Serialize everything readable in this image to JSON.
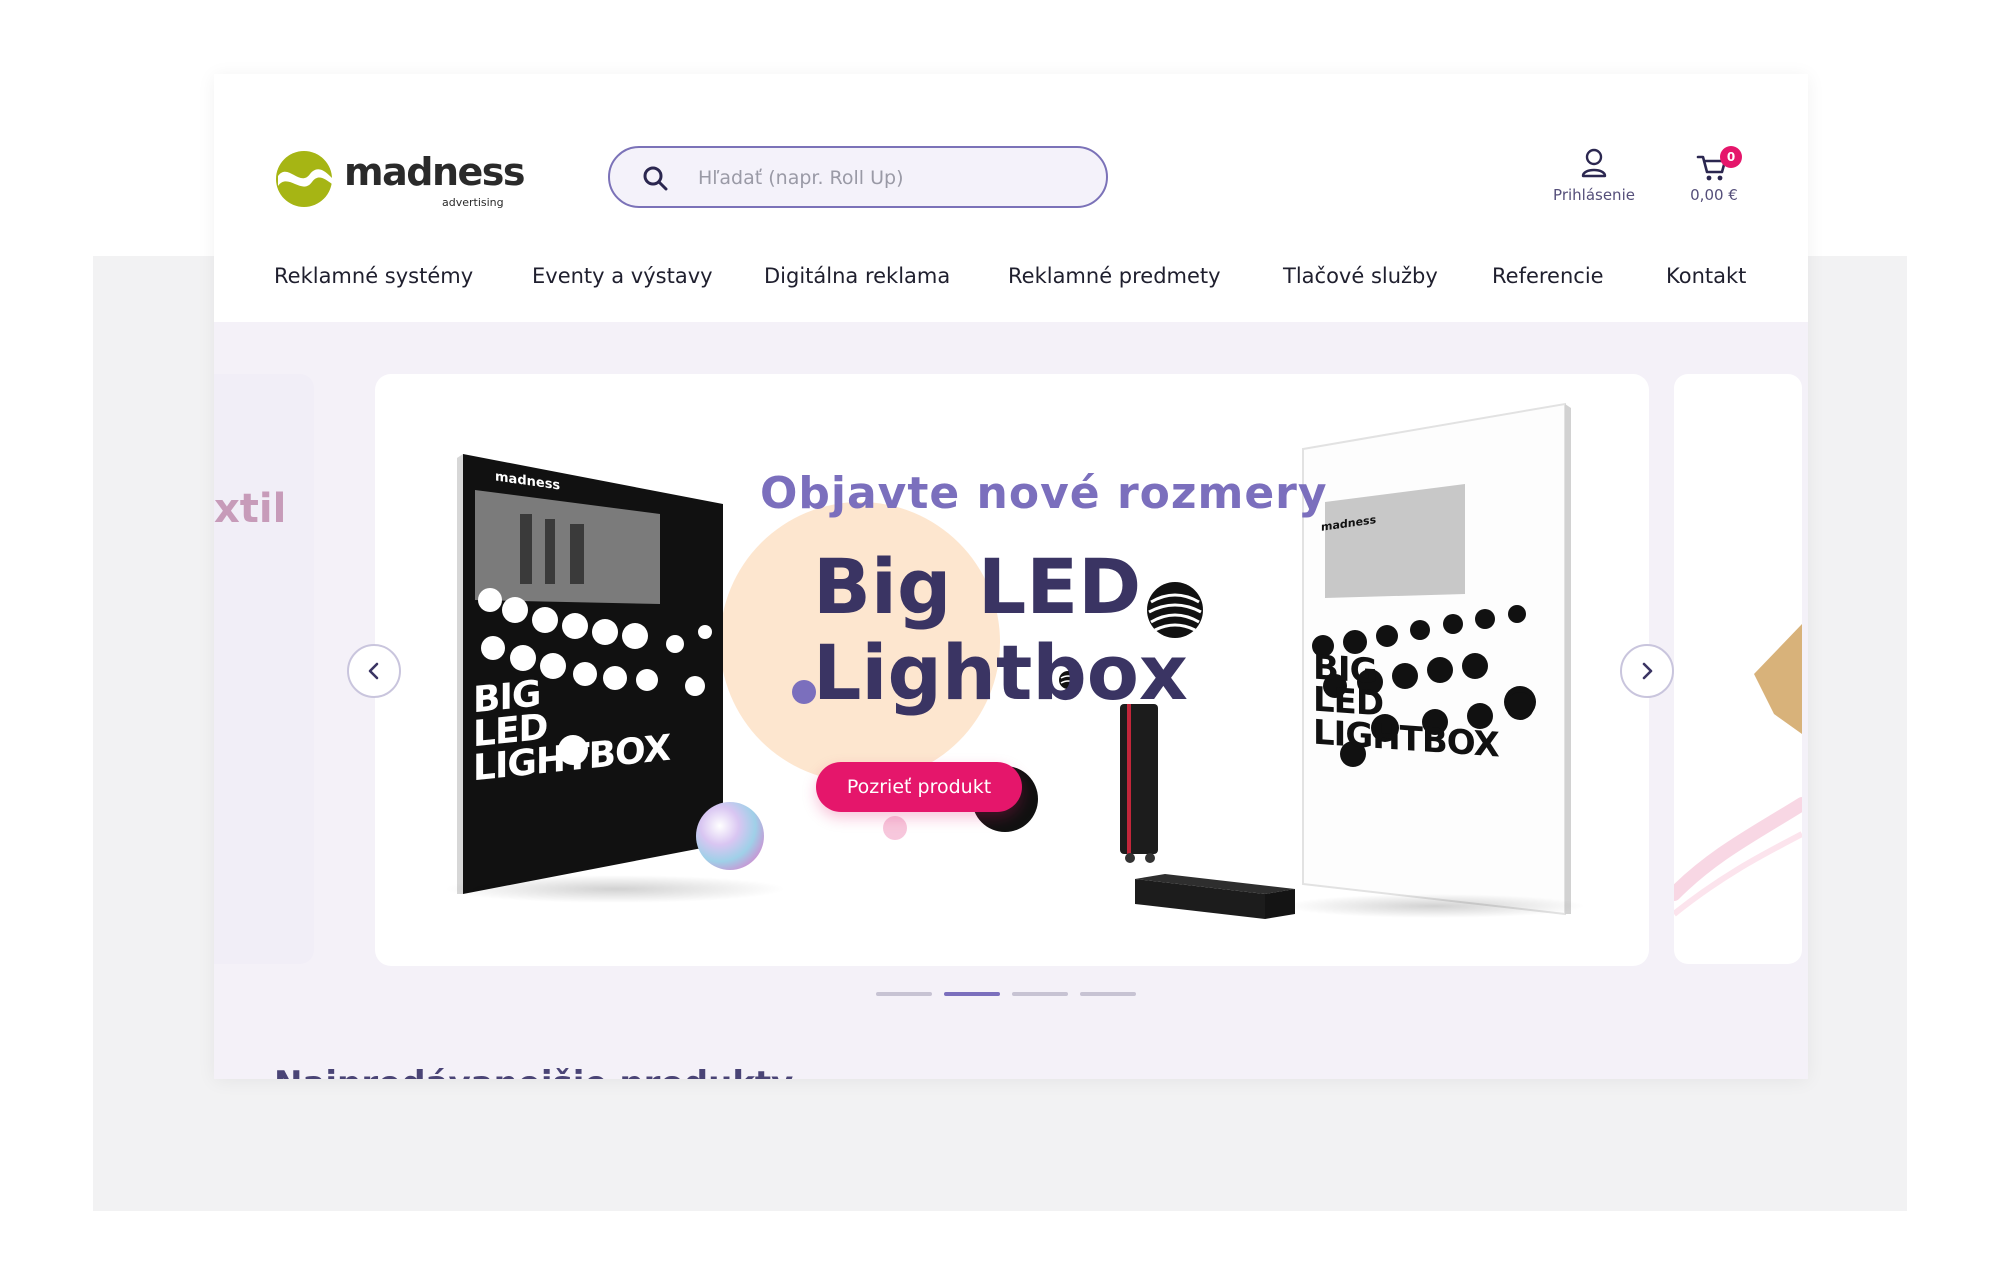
{
  "brand": {
    "name": "madness",
    "tagline": "advertising",
    "logo_color": "#a6b514"
  },
  "search": {
    "placeholder": "Hľadať (napr. Roll Up)"
  },
  "account": {
    "label": "Prihlásenie",
    "icon": "user-icon"
  },
  "cart": {
    "total": "0,00 €",
    "count": "0",
    "icon": "cart-icon"
  },
  "nav": {
    "items": [
      {
        "label": "Reklamné systémy"
      },
      {
        "label": "Eventy a výstavy"
      },
      {
        "label": "Digitálna reklama"
      },
      {
        "label": "Reklamné predmety"
      },
      {
        "label": "Tlačové služby"
      },
      {
        "label": "Referencie"
      },
      {
        "label": "Kontakt"
      }
    ]
  },
  "carousel": {
    "prev_slide_text": "xtil",
    "slide": {
      "headline": "Objavte nové rozmery",
      "title_line1": "Big LED",
      "title_line2": "Lightbox",
      "cta": "Pozrieť produkt",
      "product_text_1": "BIG",
      "product_text_2": "LED",
      "product_text_3": "LIGHTBOX",
      "product_logo": "madness"
    },
    "slide_count": 4,
    "active_index": 1
  },
  "section": {
    "title": "Najpredávanejšie produkty"
  },
  "colors": {
    "accent": "#e5166b",
    "primary": "#7b6fbd",
    "dark": "#3a3463",
    "peach": "#fde6cf"
  }
}
